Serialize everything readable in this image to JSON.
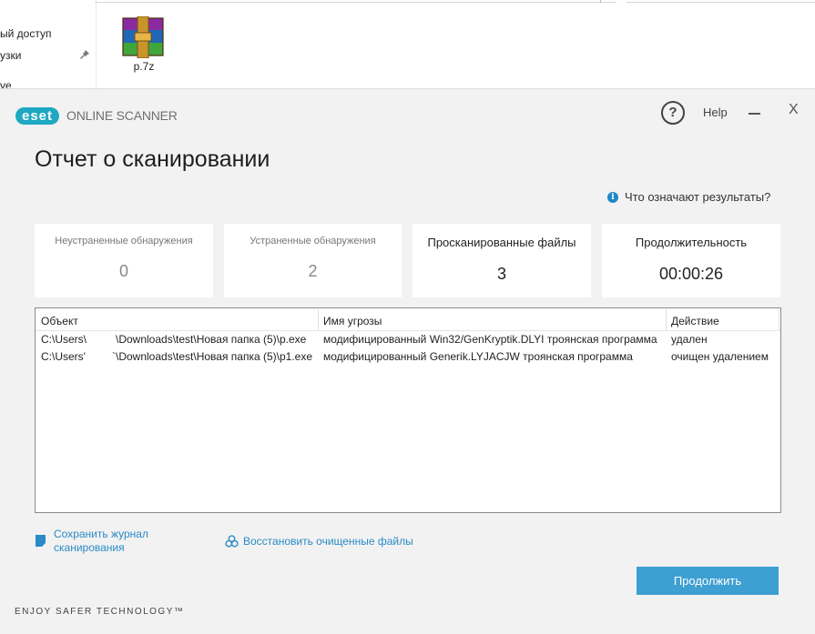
{
  "explorer": {
    "nav_items": [
      "ый доступ",
      "узки",
      "ve"
    ],
    "file_name": "p.7z"
  },
  "window": {
    "logo_text": "eset",
    "product": "ONLINE SCANNER",
    "help_symbol": "?",
    "help_label": "Help",
    "close_symbol": "X"
  },
  "report": {
    "title": "Отчет о сканировании",
    "results_help": "Что означают результаты?",
    "stats": [
      {
        "label": "Неустраненные обнаружения",
        "value": "0"
      },
      {
        "label": "Устраненные обнаружения",
        "value": "2"
      },
      {
        "label": "Просканированные файлы",
        "value": "3"
      },
      {
        "label": "Продолжительность",
        "value": "00:00:26"
      }
    ]
  },
  "table": {
    "columns": [
      "Объект",
      "Имя угрозы",
      "Действие"
    ],
    "rows": [
      {
        "path_left": "C:\\Users\\",
        "path_right": "\\Downloads\\test\\Новая папка (5)\\p.exe",
        "threat": "модифицированный Win32/GenKryptik.DLYI троянская программа",
        "action": "удален"
      },
      {
        "path_left": "C:\\Users'",
        "path_right": "`\\Downloads\\test\\Новая папка (5)\\p1.exe",
        "threat": "модифицированный Generik.LYJACJW троянская программа",
        "action": "очищен удалением"
      }
    ]
  },
  "actions": {
    "save_log_line1": "Сохранить журнал",
    "save_log_line2": "сканирования",
    "restore": "Восстановить очищенные файлы",
    "continue": "Продолжить"
  },
  "footer": {
    "tagline": "ENJOY SAFER TECHNOLOGY™"
  },
  "colors": {
    "accent": "#1fa8c3",
    "link": "#2a8bc6",
    "button": "#3d9fd2"
  }
}
